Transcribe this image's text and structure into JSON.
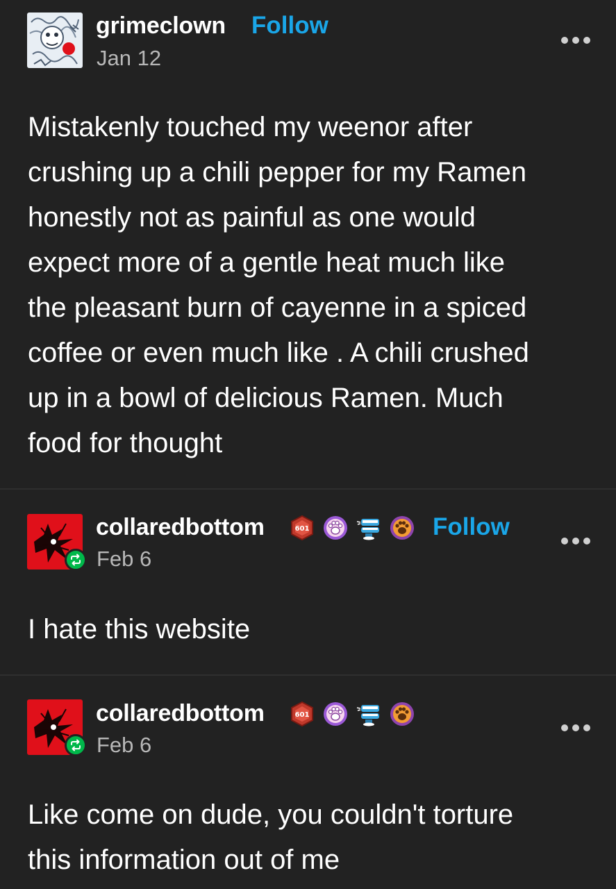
{
  "posts": [
    {
      "username": "grimeclown",
      "follow_label": "Follow",
      "date": "Jan 12",
      "avatar": "clown-doodle-avatar",
      "body_lines": [
        "Mistakenly touched my weenor after",
        "crushing up a chili pepper for my Ramen",
        "honestly not as painful as one would",
        "expect more of a gentle heat much like",
        "the pleasant burn of cayenne in a spiced",
        "coffee or even much like . A chili crushed",
        "up in a bowl of delicious Ramen. Much",
        "food for thought"
      ]
    },
    {
      "username": "collaredbottom",
      "follow_label": "Follow",
      "date": "Feb 6",
      "avatar": "red-creature-avatar",
      "reblog_icon": "reblog-icon",
      "badges": [
        "d20-badge",
        "paw-badge-pink",
        "chattering-teeth-badge",
        "paw-badge-orange"
      ],
      "body_lines": [
        "I hate this website"
      ]
    },
    {
      "username": "collaredbottom",
      "date": "Feb 6",
      "avatar": "red-creature-avatar",
      "reblog_icon": "reblog-icon",
      "badges": [
        "d20-badge",
        "paw-badge-pink",
        "chattering-teeth-badge",
        "paw-badge-orange"
      ],
      "body_lines": [
        "Like come on dude, you couldn't torture",
        "this information out of me"
      ]
    }
  ],
  "badge_text": "601",
  "colors": {
    "background": "#222222",
    "follow": "#1aa6e8",
    "reblog_badge": "#00b84a",
    "avatar_red": "#e0101a"
  }
}
